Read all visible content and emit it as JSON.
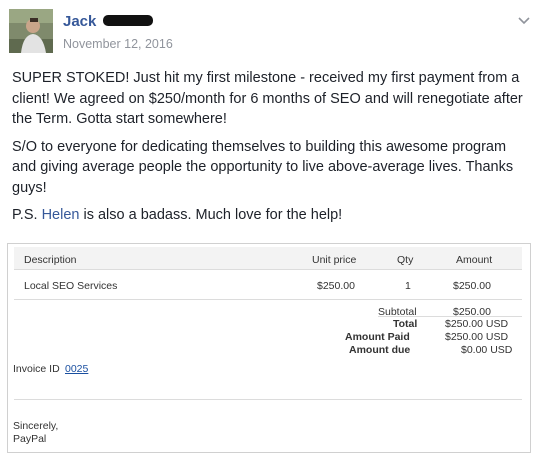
{
  "post": {
    "author": "Jack",
    "date": "November 12, 2016",
    "paragraphs": [
      "SUPER STOKED! Just hit my first milestone - received my first payment from a client! We agreed on $250/month for 6 months of SEO and will renegotiate after the Term. Gotta start somewhere!",
      "S/O to everyone for dedicating themselves to building this awesome program and giving average people the opportunity to live above-average lives. Thanks guys!"
    ],
    "ps_prefix": "P.S. ",
    "mention": "Helen",
    "ps_suffix": " is also a badass. Much love for the help!"
  },
  "invoice": {
    "headers": {
      "description": "Description",
      "unit_price": "Unit price",
      "qty": "Qty",
      "amount": "Amount"
    },
    "rows": [
      {
        "description": "Local SEO Services",
        "unit_price": "$250.00",
        "qty": "1",
        "amount": "$250.00"
      }
    ],
    "summary": {
      "subtotal_label": "Subtotal",
      "subtotal_value": "$250.00",
      "total_label": "Total",
      "total_value": "$250.00 USD",
      "paid_label": "Amount Paid",
      "paid_value": "$250.00 USD",
      "due_label": "Amount due",
      "due_value": "$0.00 USD"
    },
    "invoice_id_label": "Invoice ID",
    "invoice_id": "0025",
    "closing": "Sincerely,",
    "sender": "PayPal"
  },
  "colors": {
    "link": "#365899",
    "meta": "#90949c",
    "text": "#1d2129"
  }
}
